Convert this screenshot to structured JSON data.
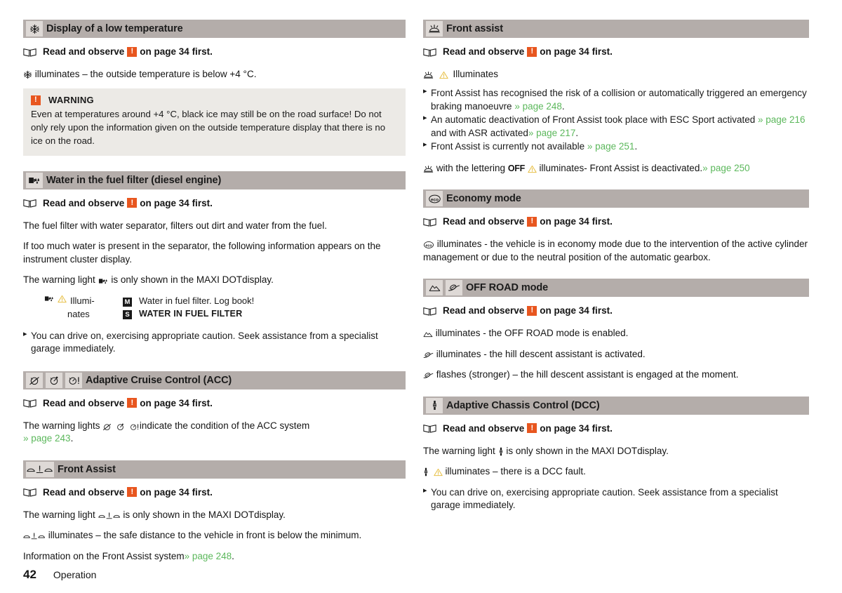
{
  "colors": {
    "header_bar": "#b4adaa",
    "icon_box": "#ded9d6",
    "warning_orange": "#e8561f",
    "callout_bg": "#eceae6",
    "link_green": "#5cb85c",
    "text": "#141414"
  },
  "read_observe": {
    "prefix": "Read and observe",
    "suffix": "on page 34 first.",
    "exclam": "!"
  },
  "left_column": {
    "sections": [
      {
        "id": "low-temperature",
        "title": "Display of a low temperature",
        "icons": [
          "snowflake-icon"
        ],
        "paragraph": "illuminates – the outside temperature is below +4 °C.",
        "callout": {
          "label": "WARNING",
          "text": "Even at temperatures around +4 °C, black ice may still be on the road surface! Do not only rely upon the information given on the outside temperature display that there is no ice on the road."
        }
      },
      {
        "id": "water-fuel-filter",
        "title": "Water in the fuel filter (diesel engine)",
        "icons": [
          "fuel-filter-water-icon"
        ],
        "paragraphs": [
          "The fuel filter with water separator, filters out dirt and water from the fuel.",
          "If too much water is present in the separator, the following information appears on the instrument cluster display.",
          "The warning light  is only shown in the MAXI DOTdisplay."
        ],
        "para3_pre": "The warning light",
        "para3_post": "is only shown in the MAXI DOTdisplay.",
        "table": {
          "left_label": "Illumi-nates",
          "left_label_line1": "Illumi-",
          "left_label_line2": "nates",
          "rows": [
            {
              "badge": "M",
              "text": "Water in fuel filter. Log book!"
            },
            {
              "badge": "S",
              "text": "WATER IN FUEL FILTER"
            }
          ]
        },
        "bullets": [
          "You can drive on, exercising appropriate caution. Seek assistance from a specialist garage immediately."
        ]
      },
      {
        "id": "acc",
        "title": "Adaptive Cruise Control (ACC)",
        "icons": [
          "acc-icon-1",
          "acc-icon-2",
          "acc-icon-warning"
        ],
        "para_pre": "The warning lights",
        "para_mid": "indicate the condition of the ACC system",
        "link": "» page 243",
        "para_end": "."
      },
      {
        "id": "front-assist",
        "title": "Front Assist",
        "icons": [
          "front-assist-distance-icon"
        ],
        "para1_pre": "The warning light",
        "para1_post": "is only shown in the MAXI DOTdisplay.",
        "para2_post": "illuminates – the safe distance to the vehicle in front is below the minimum.",
        "para3_pre": "Information on the Front Assist system",
        "para3_link": "» page 248",
        "para3_end": "."
      }
    ]
  },
  "right_column": {
    "sections": [
      {
        "id": "front-assist-2",
        "title": "Front assist",
        "icons": [
          "front-assist-car-icon"
        ],
        "illuminates_label": "Illuminates",
        "bullets": [
          {
            "text": "Front Assist has recognised the risk of a collision or automatically triggered an emergency braking manoeuvre",
            "link": "» page 248",
            "end": "."
          },
          {
            "text": "An automatic deactivation of Front Assist took place with ESC Sport activated",
            "link": "» page 216",
            "mid": "and with ASR activated",
            "link2": "» page 217",
            "end": "."
          },
          {
            "text": "Front Assist is currently not available",
            "link": "» page 251",
            "end": "."
          }
        ],
        "footer_pre": "with the lettering",
        "footer_off": "OFF",
        "footer_post": "illuminates- Front Assist is deactivated.",
        "footer_link": "» page 250"
      },
      {
        "id": "economy-mode",
        "title": "Economy mode",
        "icons": [
          "eco-icon"
        ],
        "paragraph": "illuminates - the vehicle is in economy mode due to the intervention of the active cylinder management or due to the neutral position of the automatic gearbox."
      },
      {
        "id": "off-road-mode",
        "title": "OFF ROAD mode",
        "icons": [
          "mountain-icon",
          "hill-descent-icon"
        ],
        "lines": [
          {
            "icon": "mountain-icon",
            "text": "illuminates - the OFF ROAD mode is enabled."
          },
          {
            "icon": "hill-descent-icon",
            "text": "illuminates - the hill descent assistant is activated."
          },
          {
            "icon": "hill-descent-icon",
            "text": "flashes (stronger) – the hill descent assistant is engaged at the moment."
          }
        ]
      },
      {
        "id": "dcc",
        "title": "Adaptive Chassis Control (DCC)",
        "icons": [
          "dcc-shock-absorber-icon"
        ],
        "para1_pre": "The warning light",
        "para1_post": "is only shown in the MAXI DOTdisplay.",
        "para2_post": "illuminates – there is a DCC fault.",
        "bullets": [
          "You can drive on, exercising appropriate caution. Seek assistance from a specialist garage immediately."
        ]
      }
    ]
  },
  "footer": {
    "page_number": "42",
    "chapter": "Operation"
  }
}
